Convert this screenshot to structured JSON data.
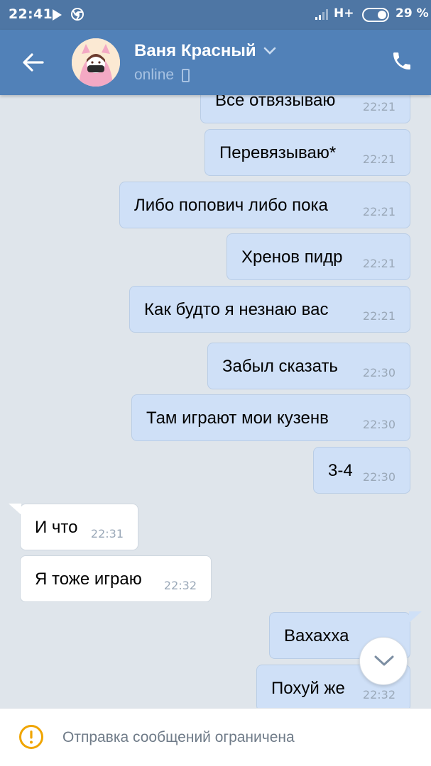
{
  "status_bar": {
    "time": "22:41",
    "network": "H+",
    "battery": "29 %"
  },
  "header": {
    "contact_name": "Ваня Красный",
    "status": "online",
    "back_icon": "arrow-left-icon",
    "call_icon": "phone-icon"
  },
  "messages": [
    {
      "text": "Все отвязываю",
      "time": "22:21",
      "dir": "out"
    },
    {
      "text": "Перевязываю*",
      "time": "22:21",
      "dir": "out"
    },
    {
      "text": "Либо попович либо пока",
      "time": "22:21",
      "dir": "out"
    },
    {
      "text": "Хренов пидр",
      "time": "22:21",
      "dir": "out"
    },
    {
      "text": "Как будто я незнаю вас",
      "time": "22:21",
      "dir": "out"
    },
    {
      "text": "Забыл сказать",
      "time": "22:30",
      "dir": "out"
    },
    {
      "text": "Там играют мои кузенв",
      "time": "22:30",
      "dir": "out"
    },
    {
      "text": "3-4",
      "time": "22:30",
      "dir": "out"
    },
    {
      "text": "И что",
      "time": "22:31",
      "dir": "in"
    },
    {
      "text": "Я тоже играю",
      "time": "22:32",
      "dir": "in"
    },
    {
      "text": "Вахахха",
      "time": "",
      "dir": "out"
    },
    {
      "text": "Похуй же",
      "time": "22:32",
      "dir": "out"
    }
  ],
  "footer": {
    "notice": "Отправка сообщений ограничена",
    "icon": "warning-icon"
  },
  "colors": {
    "header": "#5181b8",
    "status_bar": "#4e76a4",
    "chat_bg": "#dfe5eb",
    "outgoing_bubble": "#cfe0f7",
    "incoming_bubble": "#ffffff",
    "warning": "#f0a500"
  }
}
